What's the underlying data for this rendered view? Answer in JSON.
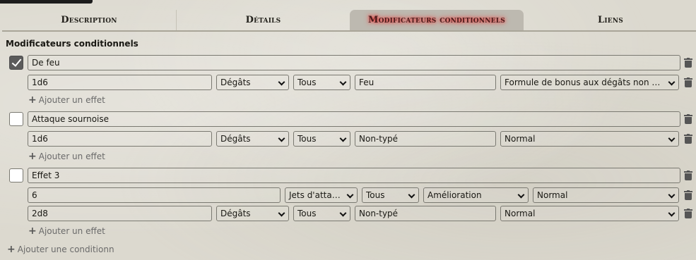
{
  "tabs": [
    {
      "label": "Description",
      "active": false
    },
    {
      "label": "Détails",
      "active": false
    },
    {
      "label": "Modificateurs conditionnels",
      "active": true
    },
    {
      "label": "Liens",
      "active": false
    }
  ],
  "section_title": "Modificateurs conditionnels",
  "conditions": [
    {
      "name": "De feu",
      "checked": true,
      "effects": [
        {
          "formula": "1d6",
          "target": "Dégâts",
          "subtarget": "Tous",
          "type": "Feu",
          "extra": "Formule de bonus aux dégâts non critique"
        }
      ]
    },
    {
      "name": "Attaque sournoise",
      "checked": false,
      "effects": [
        {
          "formula": "1d6",
          "target": "Dégâts",
          "subtarget": "Tous",
          "type": "Non-typé",
          "extra": "Normal"
        }
      ]
    },
    {
      "name": "Effet 3",
      "checked": false,
      "effects": [
        {
          "formula": "6",
          "target": "Jets d'attaque",
          "subtarget": "Tous",
          "type": "Amélioration",
          "extra": "Normal"
        },
        {
          "formula": "2d8",
          "target": "Dégâts",
          "subtarget": "Tous",
          "type": "Non-typé",
          "extra": "Normal"
        }
      ]
    }
  ],
  "add_effect_label": "Ajouter un effet",
  "add_condition_label": "Ajouter une conditionn",
  "icons": {
    "delete": "trash-icon",
    "add": "plus-icon",
    "check": "checkmark-icon"
  },
  "colors": {
    "active_tab_glow": "#e62f2f",
    "active_tab_bg": "#bdb9b0",
    "checkbox_on": "#5b5b5b"
  }
}
